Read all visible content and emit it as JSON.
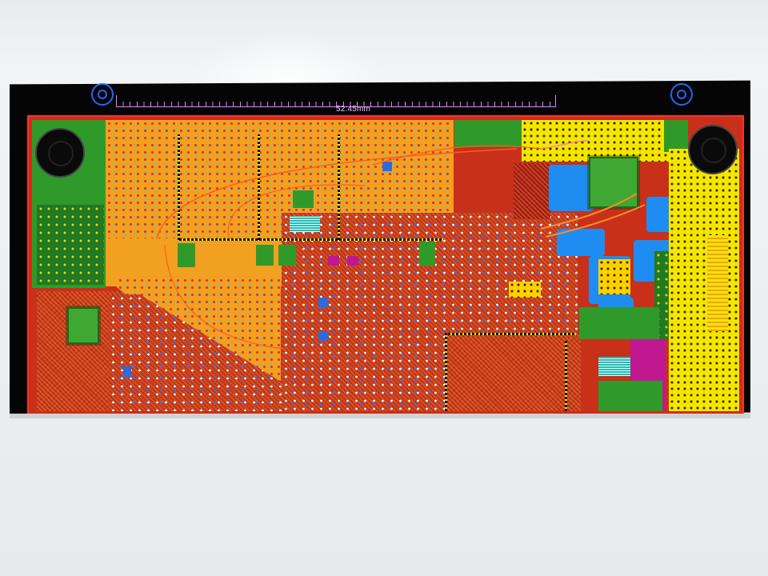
{
  "ruler": {
    "label": "52.45mm"
  },
  "colors": {
    "board_outline": "#ff3030",
    "ratsnest": "#ff5a1e",
    "ruler": "#e080ff",
    "corner_marks": "#2266ff"
  },
  "icons": {
    "corner_marks": "target-circle-icon",
    "mount_holes": "mounting-hole-icon"
  }
}
